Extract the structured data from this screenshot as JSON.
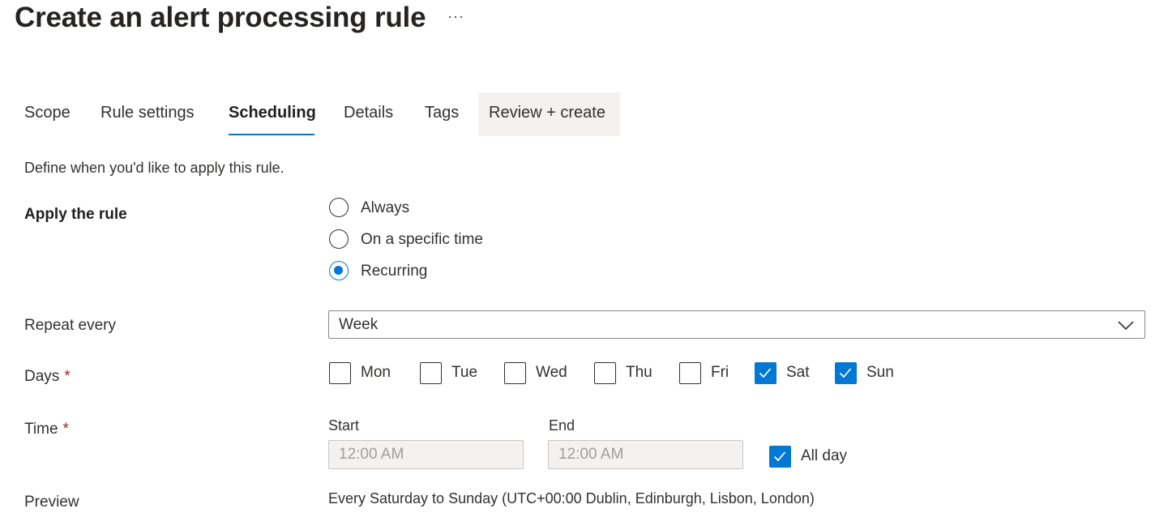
{
  "header": {
    "title": "Create an alert processing rule",
    "more_label": "···"
  },
  "tabs": [
    {
      "label": "Scope"
    },
    {
      "label": "Rule settings"
    },
    {
      "label": "Scheduling",
      "active": true
    },
    {
      "label": "Details"
    },
    {
      "label": "Tags"
    },
    {
      "label": "Review + create"
    }
  ],
  "scheduling": {
    "description": "Define when you'd like to apply this rule.",
    "apply_rule": {
      "label": "Apply the rule",
      "options": [
        {
          "label": "Always",
          "selected": false
        },
        {
          "label": "On a specific time",
          "selected": false
        },
        {
          "label": "Recurring",
          "selected": true
        }
      ]
    },
    "repeat_every": {
      "label": "Repeat every",
      "value": "Week"
    },
    "days": {
      "label": "Days",
      "required_mark": "*",
      "items": [
        {
          "label": "Mon",
          "checked": false
        },
        {
          "label": "Tue",
          "checked": false
        },
        {
          "label": "Wed",
          "checked": false
        },
        {
          "label": "Thu",
          "checked": false
        },
        {
          "label": "Fri",
          "checked": false
        },
        {
          "label": "Sat",
          "checked": true
        },
        {
          "label": "Sun",
          "checked": true
        }
      ]
    },
    "time": {
      "label": "Time",
      "required_mark": "*",
      "start_label": "Start",
      "start_value": "12:00 AM",
      "end_label": "End",
      "end_value": "12:00 AM",
      "all_day_label": "All day",
      "all_day_checked": true
    },
    "preview": {
      "label": "Preview",
      "text": "Every Saturday to Sunday (UTC+00:00 Dublin, Edinburgh, Lisbon, London)"
    }
  },
  "colors": {
    "accent": "#0078d4",
    "required": "#a4262c",
    "disabled_bg": "#f3f2f1"
  }
}
